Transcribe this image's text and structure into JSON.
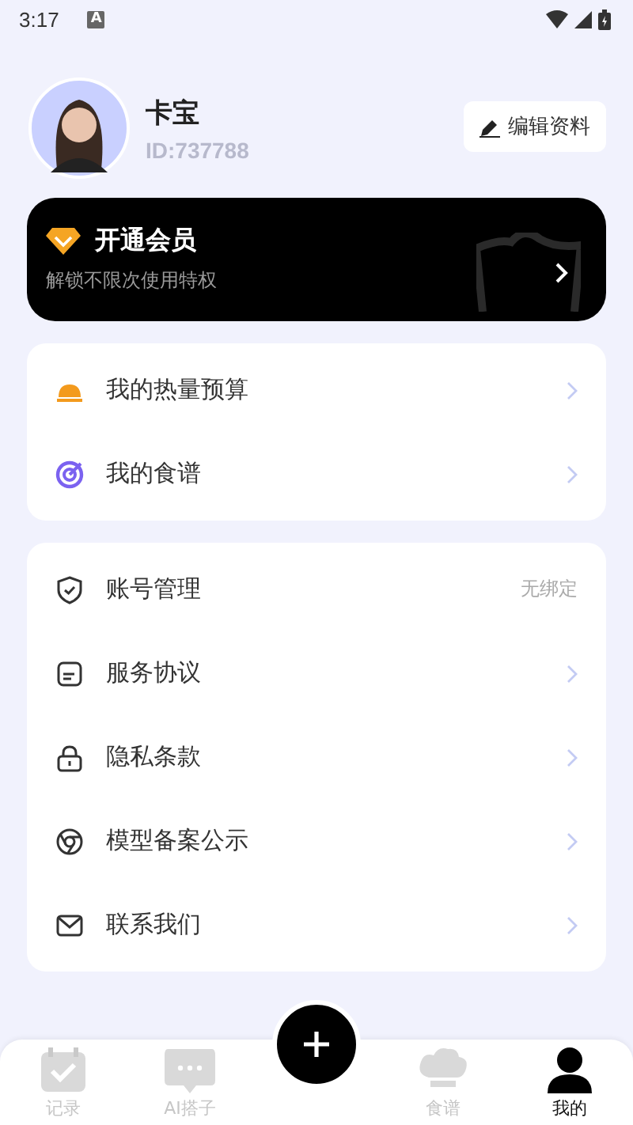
{
  "status_bar": {
    "time": "3:17",
    "notification": "A"
  },
  "profile": {
    "name": "卡宝",
    "id": "ID:737788",
    "edit_button": "编辑资料"
  },
  "member_card": {
    "title": "开通会员",
    "subtitle": "解锁不限次使用特权"
  },
  "menu_groups": [
    {
      "items": [
        {
          "label": "我的热量预算"
        },
        {
          "label": "我的食谱"
        }
      ]
    },
    {
      "items": [
        {
          "label": "账号管理",
          "value": "无绑定"
        },
        {
          "label": "服务协议"
        },
        {
          "label": "隐私条款"
        },
        {
          "label": "模型备案公示"
        },
        {
          "label": "联系我们"
        }
      ]
    }
  ],
  "tab_bar": {
    "tabs": [
      {
        "label": "记录",
        "selected": false
      },
      {
        "label": "AI搭子",
        "selected": false
      },
      {
        "label": "食谱",
        "selected": false
      },
      {
        "label": "我的",
        "selected": true
      }
    ]
  }
}
